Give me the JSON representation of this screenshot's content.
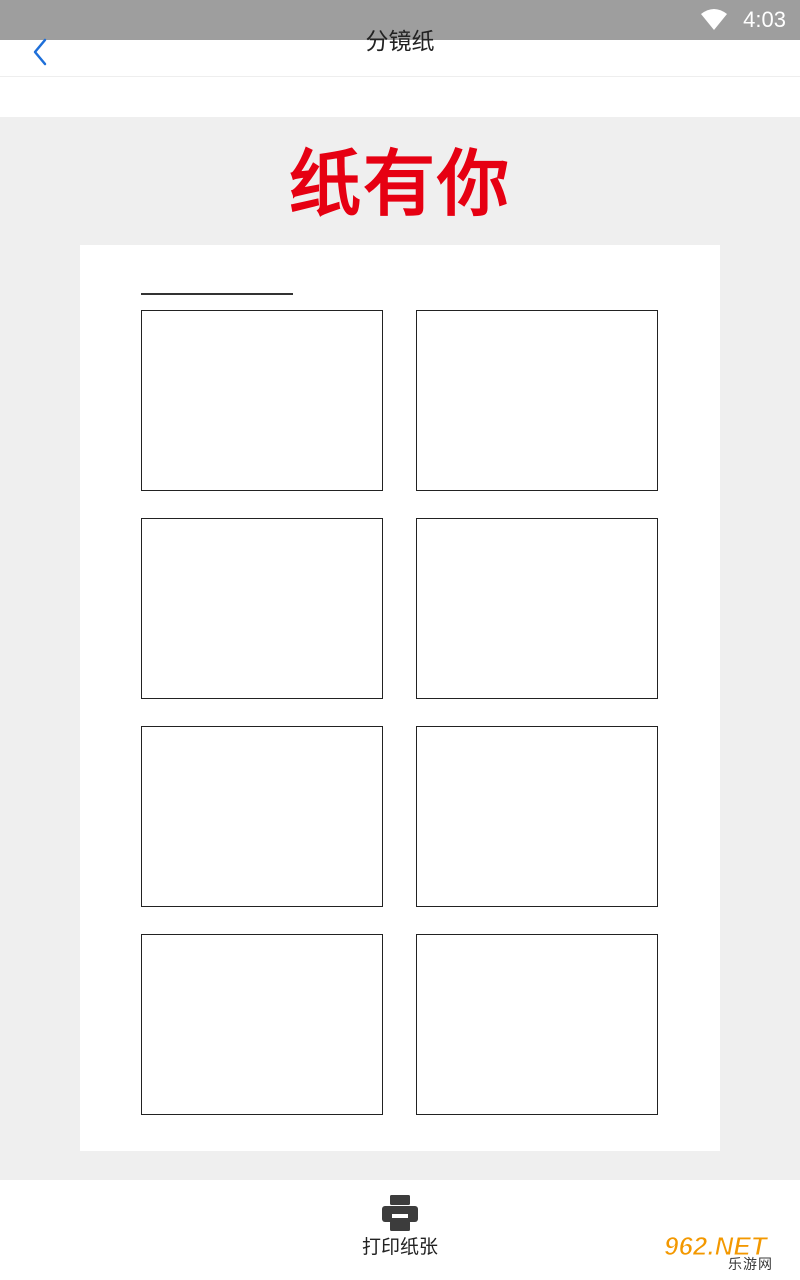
{
  "status_bar": {
    "time": "4:03",
    "icons": [
      "wifi-icon"
    ]
  },
  "header": {
    "title": "分镜纸",
    "back_icon": "chevron-left-icon"
  },
  "preview": {
    "brand_title": "纸有你",
    "brand_color": "#e60012",
    "paper": {
      "panel_rows": 4,
      "panel_columns": 2
    }
  },
  "bottom_bar": {
    "print_icon": "printer-icon",
    "print_label": "打印纸张"
  },
  "watermark": {
    "main": "962.NET",
    "sub": "乐游网",
    "color": "#f39800"
  },
  "colors": {
    "accent": "#1e6fd9",
    "status_bar": "#9e9e9e",
    "preview_background": "#efefef"
  }
}
